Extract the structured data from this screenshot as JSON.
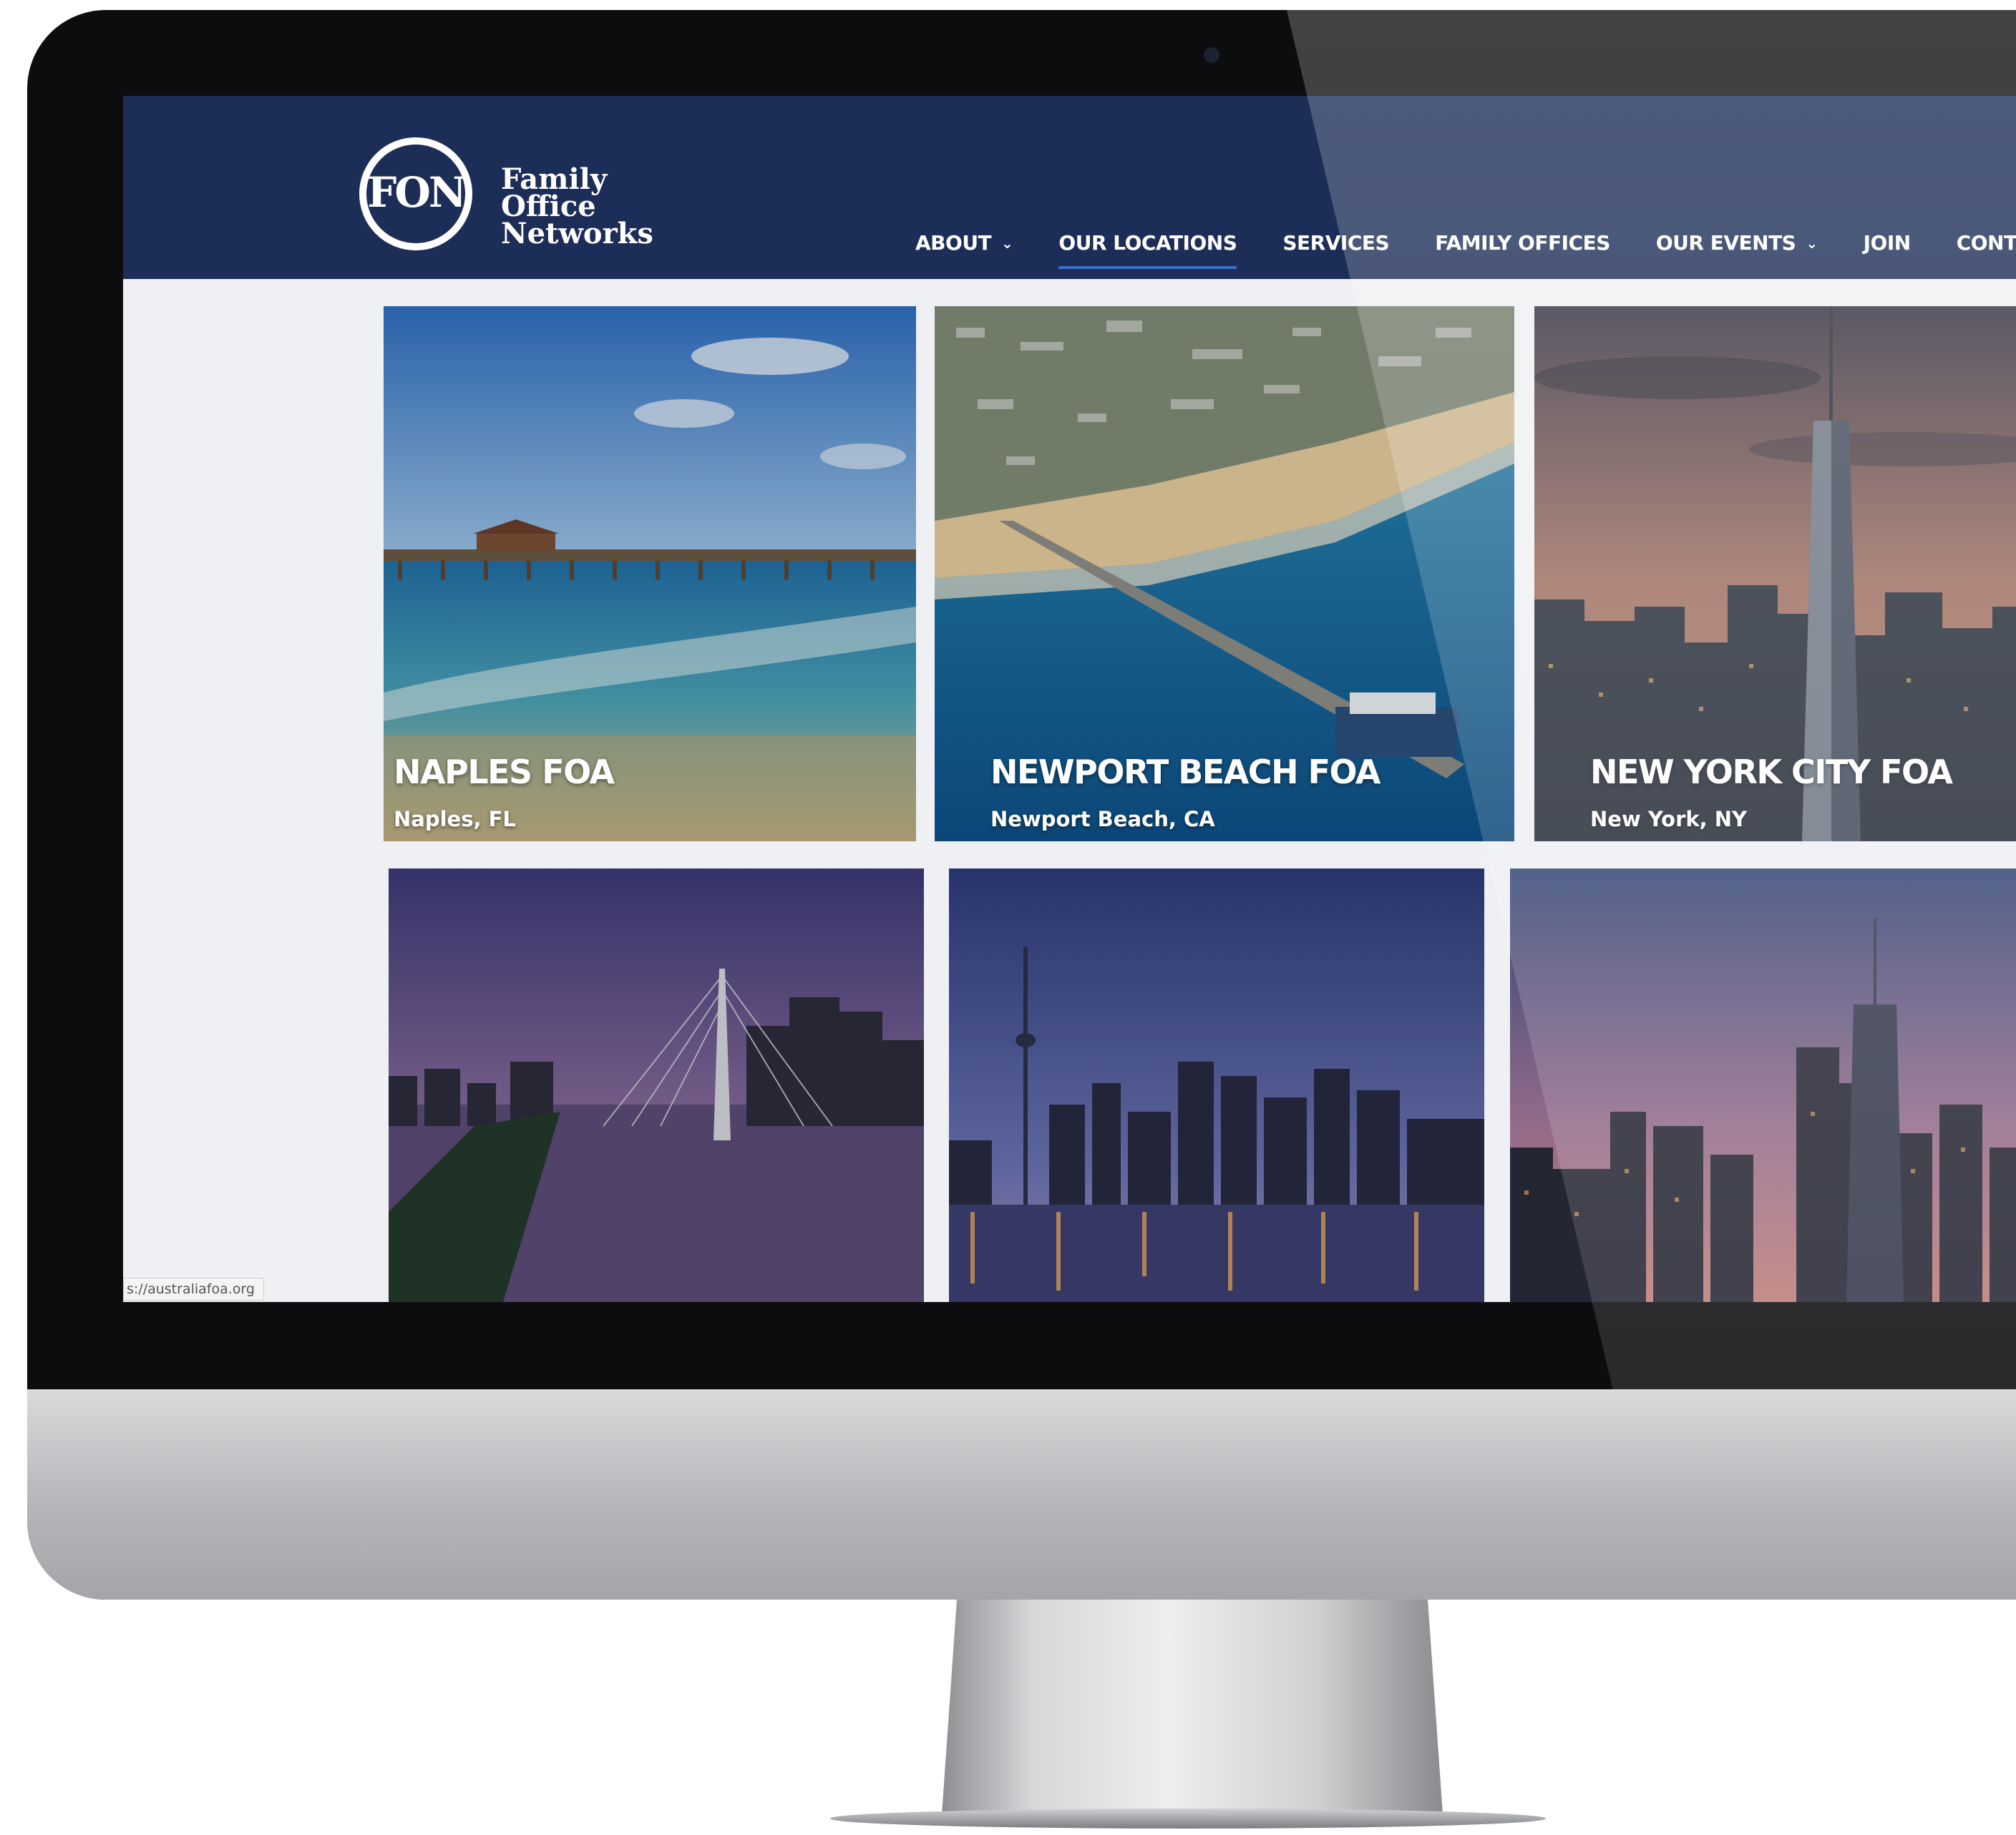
{
  "brand": {
    "logo_mark": "FON",
    "name_lines": [
      "Family",
      "Office",
      "Networks"
    ]
  },
  "nav": [
    {
      "label": "ABOUT",
      "has_dropdown": true,
      "active": false
    },
    {
      "label": "OUR LOCATIONS",
      "has_dropdown": false,
      "active": true
    },
    {
      "label": "SERVICES",
      "has_dropdown": false,
      "active": false
    },
    {
      "label": "FAMILY OFFICES",
      "has_dropdown": false,
      "active": false
    },
    {
      "label": "OUR EVENTS",
      "has_dropdown": true,
      "active": false
    },
    {
      "label": "JOIN",
      "has_dropdown": false,
      "active": false
    },
    {
      "label": "CONTACT US",
      "has_dropdown": false,
      "active": false
    }
  ],
  "locations": [
    {
      "title": "NAPLES FOA",
      "subtitle": "Naples, FL",
      "scene": "beach-pier"
    },
    {
      "title": "NEWPORT BEACH FOA",
      "subtitle": "Newport Beach, CA",
      "scene": "aerial-pier"
    },
    {
      "title": "NEW YORK CITY FOA",
      "subtitle": "New York, NY",
      "scene": "skyline-dusk"
    },
    {
      "title": "",
      "subtitle": "",
      "scene": "bridge-river"
    },
    {
      "title": "",
      "subtitle": "",
      "scene": "tower-skyline"
    },
    {
      "title": "",
      "subtitle": "",
      "scene": "city-lake"
    }
  ],
  "status_bar": {
    "url": "s://australiafoa.org"
  },
  "colors": {
    "header_bg": "#1c2d57",
    "active_underline": "#3d6fc4",
    "page_bg": "#eef0f3"
  }
}
